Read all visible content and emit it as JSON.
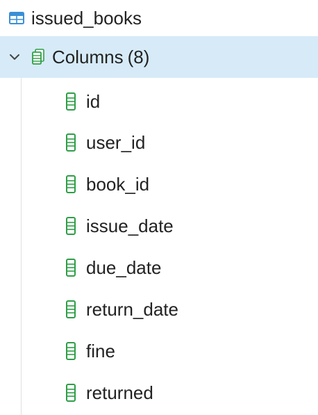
{
  "tree": {
    "table": {
      "label": "issued_books",
      "icon": "table-icon"
    },
    "columns_node": {
      "label": "Columns",
      "count": "(8)",
      "expanded": true,
      "icon": "columns-icon",
      "chevron_icon": "chevron-down-icon"
    },
    "columns": [
      {
        "label": "id"
      },
      {
        "label": "user_id"
      },
      {
        "label": "book_id"
      },
      {
        "label": "issue_date"
      },
      {
        "label": "due_date"
      },
      {
        "label": "return_date"
      },
      {
        "label": "fine"
      },
      {
        "label": "returned"
      }
    ]
  },
  "colors": {
    "selected_row_bg": "#d6ebf7",
    "table_icon": "#3b8fd6",
    "column_icon": "#2e9e47",
    "text": "#222222"
  }
}
